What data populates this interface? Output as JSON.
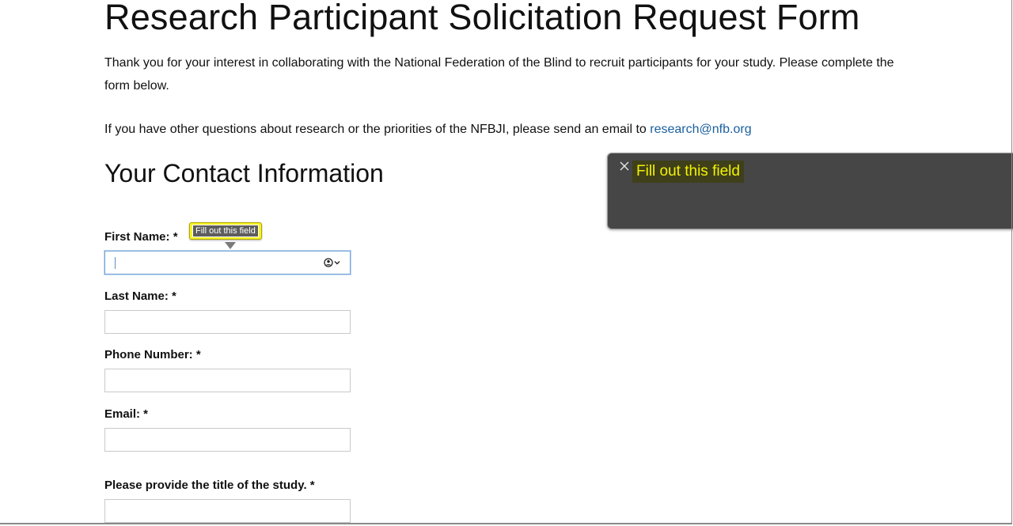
{
  "page": {
    "title": "Research Participant Solicitation Request Form",
    "intro": "Thank you for your interest in collaborating with the National Federation of the Blind to recruit participants for your study. Please complete the form below.",
    "contact_prefix": "If you have other questions about research or the priorities of the NFBJI, please send an email to ",
    "contact_email": "research@nfb.org",
    "section_title": "Your Contact Information"
  },
  "form": {
    "first_name": {
      "label": "First Name: *",
      "value": "",
      "focused": true
    },
    "last_name": {
      "label": "Last Name: *",
      "value": ""
    },
    "phone": {
      "label": "Phone Number: *",
      "value": ""
    },
    "email": {
      "label": "Email: *",
      "value": ""
    },
    "study_title": {
      "label": "Please provide the title of the study. *",
      "value": ""
    }
  },
  "validation": {
    "message": "Fill out this field"
  },
  "caption_panel": {
    "text": "Fill out this field",
    "close_icon": "close-icon"
  },
  "colors": {
    "link": "#1a5f9e",
    "highlight_yellow": "#f5f520",
    "caption_bg": "#464646",
    "caption_text": "#f3f300",
    "focus_border": "#7aa7d8"
  },
  "icons": {
    "autofill": "contact-autofill-icon",
    "chevron": "chevron-down-icon"
  }
}
